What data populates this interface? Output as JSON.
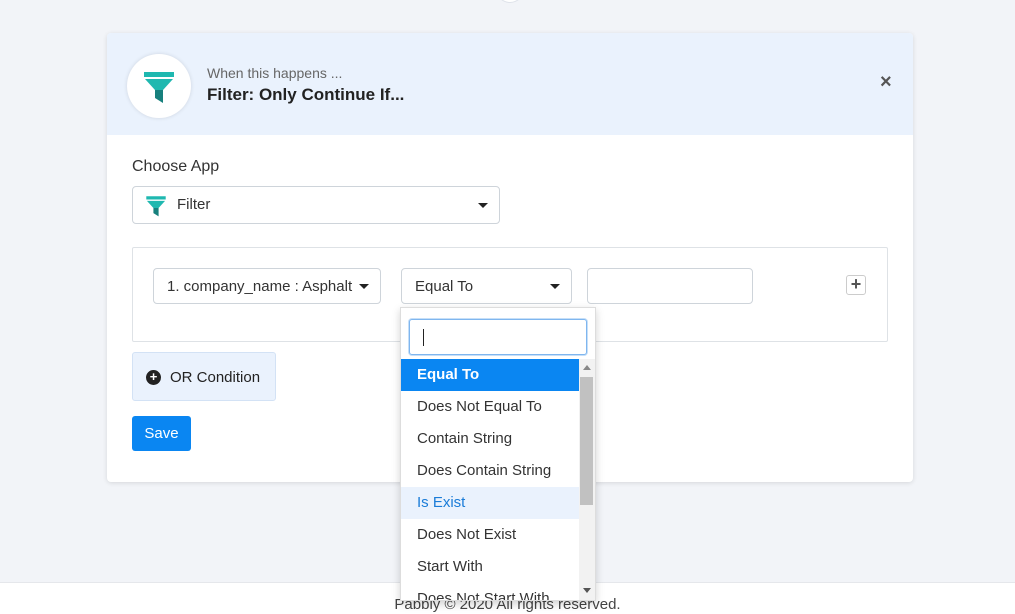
{
  "header": {
    "subtitle": "When this happens ...",
    "title": "Filter: Only Continue If...",
    "close_glyph": "×",
    "icon": "filter-funnel-icon"
  },
  "choose_app": {
    "label": "Choose App",
    "selected": "Filter"
  },
  "condition": {
    "field": "1. company_name : Asphalt",
    "operator": "Equal To",
    "value": "",
    "add_glyph": "+"
  },
  "or_condition": {
    "label": "OR Condition",
    "icon_glyph": "+"
  },
  "save": {
    "label": "Save"
  },
  "footer": {
    "text": "Pabbly © 2020 All rights reserved."
  },
  "operator_dropdown": {
    "search_value": "",
    "options": [
      {
        "label": "Equal To",
        "state": "selected"
      },
      {
        "label": "Does Not Equal To",
        "state": ""
      },
      {
        "label": "Contain String",
        "state": ""
      },
      {
        "label": "Does Contain String",
        "state": ""
      },
      {
        "label": "Is Exist",
        "state": "hover"
      },
      {
        "label": "Does Not Exist",
        "state": ""
      },
      {
        "label": "Start With",
        "state": ""
      },
      {
        "label": "Does Not Start With",
        "state": ""
      }
    ]
  },
  "colors": {
    "accent": "#0a86f2",
    "filter_icon_teal": "#1fb8b0",
    "filter_icon_dark": "#17807d",
    "header_bg": "#eaf2fd"
  }
}
